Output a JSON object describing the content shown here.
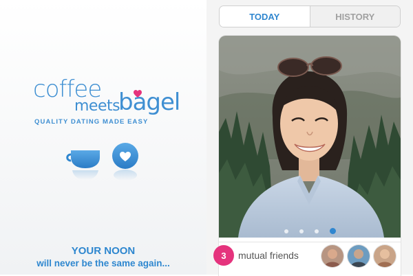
{
  "logo": {
    "coffee": "coffee",
    "meets": "meets",
    "bagel": "bagel",
    "tagline": "QUALITY DATING MADE EASY"
  },
  "icons": {
    "cup": "coffee-cup-icon",
    "heart": "heart-icon"
  },
  "promo": {
    "title": "YOUR NOON",
    "subtitle": "will never be the same again..."
  },
  "tabs": [
    {
      "label": "TODAY",
      "active": true
    },
    {
      "label": "HISTORY",
      "active": false
    }
  ],
  "profile": {
    "photo_pages": 4,
    "active_page": 4,
    "mutual_friends_count": "3",
    "mutual_friends_label": "mutual friends"
  },
  "colors": {
    "brand_blue": "#3f8fd2",
    "accent_pink": "#e5337d",
    "tab_inactive": "#a0a0a0"
  }
}
